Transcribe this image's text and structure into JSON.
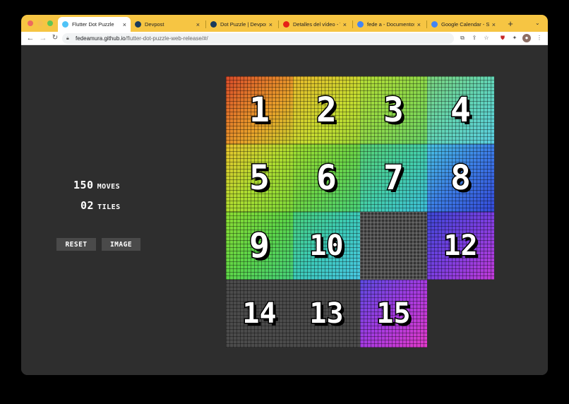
{
  "browser": {
    "tabs": [
      {
        "title": "Flutter Dot Puzzle",
        "active": true,
        "icon": "flutter-icon",
        "color": "#4fc3f7"
      },
      {
        "title": "Devpost",
        "active": false,
        "icon": "devpost-icon",
        "color": "#1a3b5c"
      },
      {
        "title": "Dot Puzzle | Devpost",
        "active": false,
        "icon": "devpost-icon",
        "color": "#1a3b5c"
      },
      {
        "title": "Detalles del vídeo - Yo",
        "active": false,
        "icon": "youtube-icon",
        "color": "#e62117"
      },
      {
        "title": "fede a - Documentos d",
        "active": false,
        "icon": "docs-icon",
        "color": "#4285f4"
      },
      {
        "title": "Google Calendar - Sem",
        "active": false,
        "icon": "calendar-icon",
        "color": "#4285f4"
      }
    ],
    "url_host": "fedeamura.github.io",
    "url_path": "/flutter-dot-puzzle-web-release/#/"
  },
  "game": {
    "moves_value": "150",
    "moves_label": "MOVES",
    "tiles_value": "02",
    "tiles_label": "TILES",
    "reset_label": "RESET",
    "image_label": "IMAGE",
    "tiles": [
      {
        "label": "1",
        "slot": 0
      },
      {
        "label": "2",
        "slot": 1
      },
      {
        "label": "3",
        "slot": 2
      },
      {
        "label": "4",
        "slot": 3
      },
      {
        "label": "5",
        "slot": 4
      },
      {
        "label": "6",
        "slot": 5
      },
      {
        "label": "7",
        "slot": 6
      },
      {
        "label": "8",
        "slot": 7
      },
      {
        "label": "9",
        "slot": 8
      },
      {
        "label": "10",
        "slot": 9
      },
      {
        "label": "12",
        "slot": 11
      },
      {
        "label": "14",
        "slot": 12
      },
      {
        "label": "13",
        "slot": 13
      },
      {
        "label": "15",
        "slot": 14
      }
    ],
    "empty_slot": 10
  },
  "colors": {
    "tabbar": "#f6c543",
    "background": "#2e2e2e",
    "button": "#4a4a4a"
  }
}
